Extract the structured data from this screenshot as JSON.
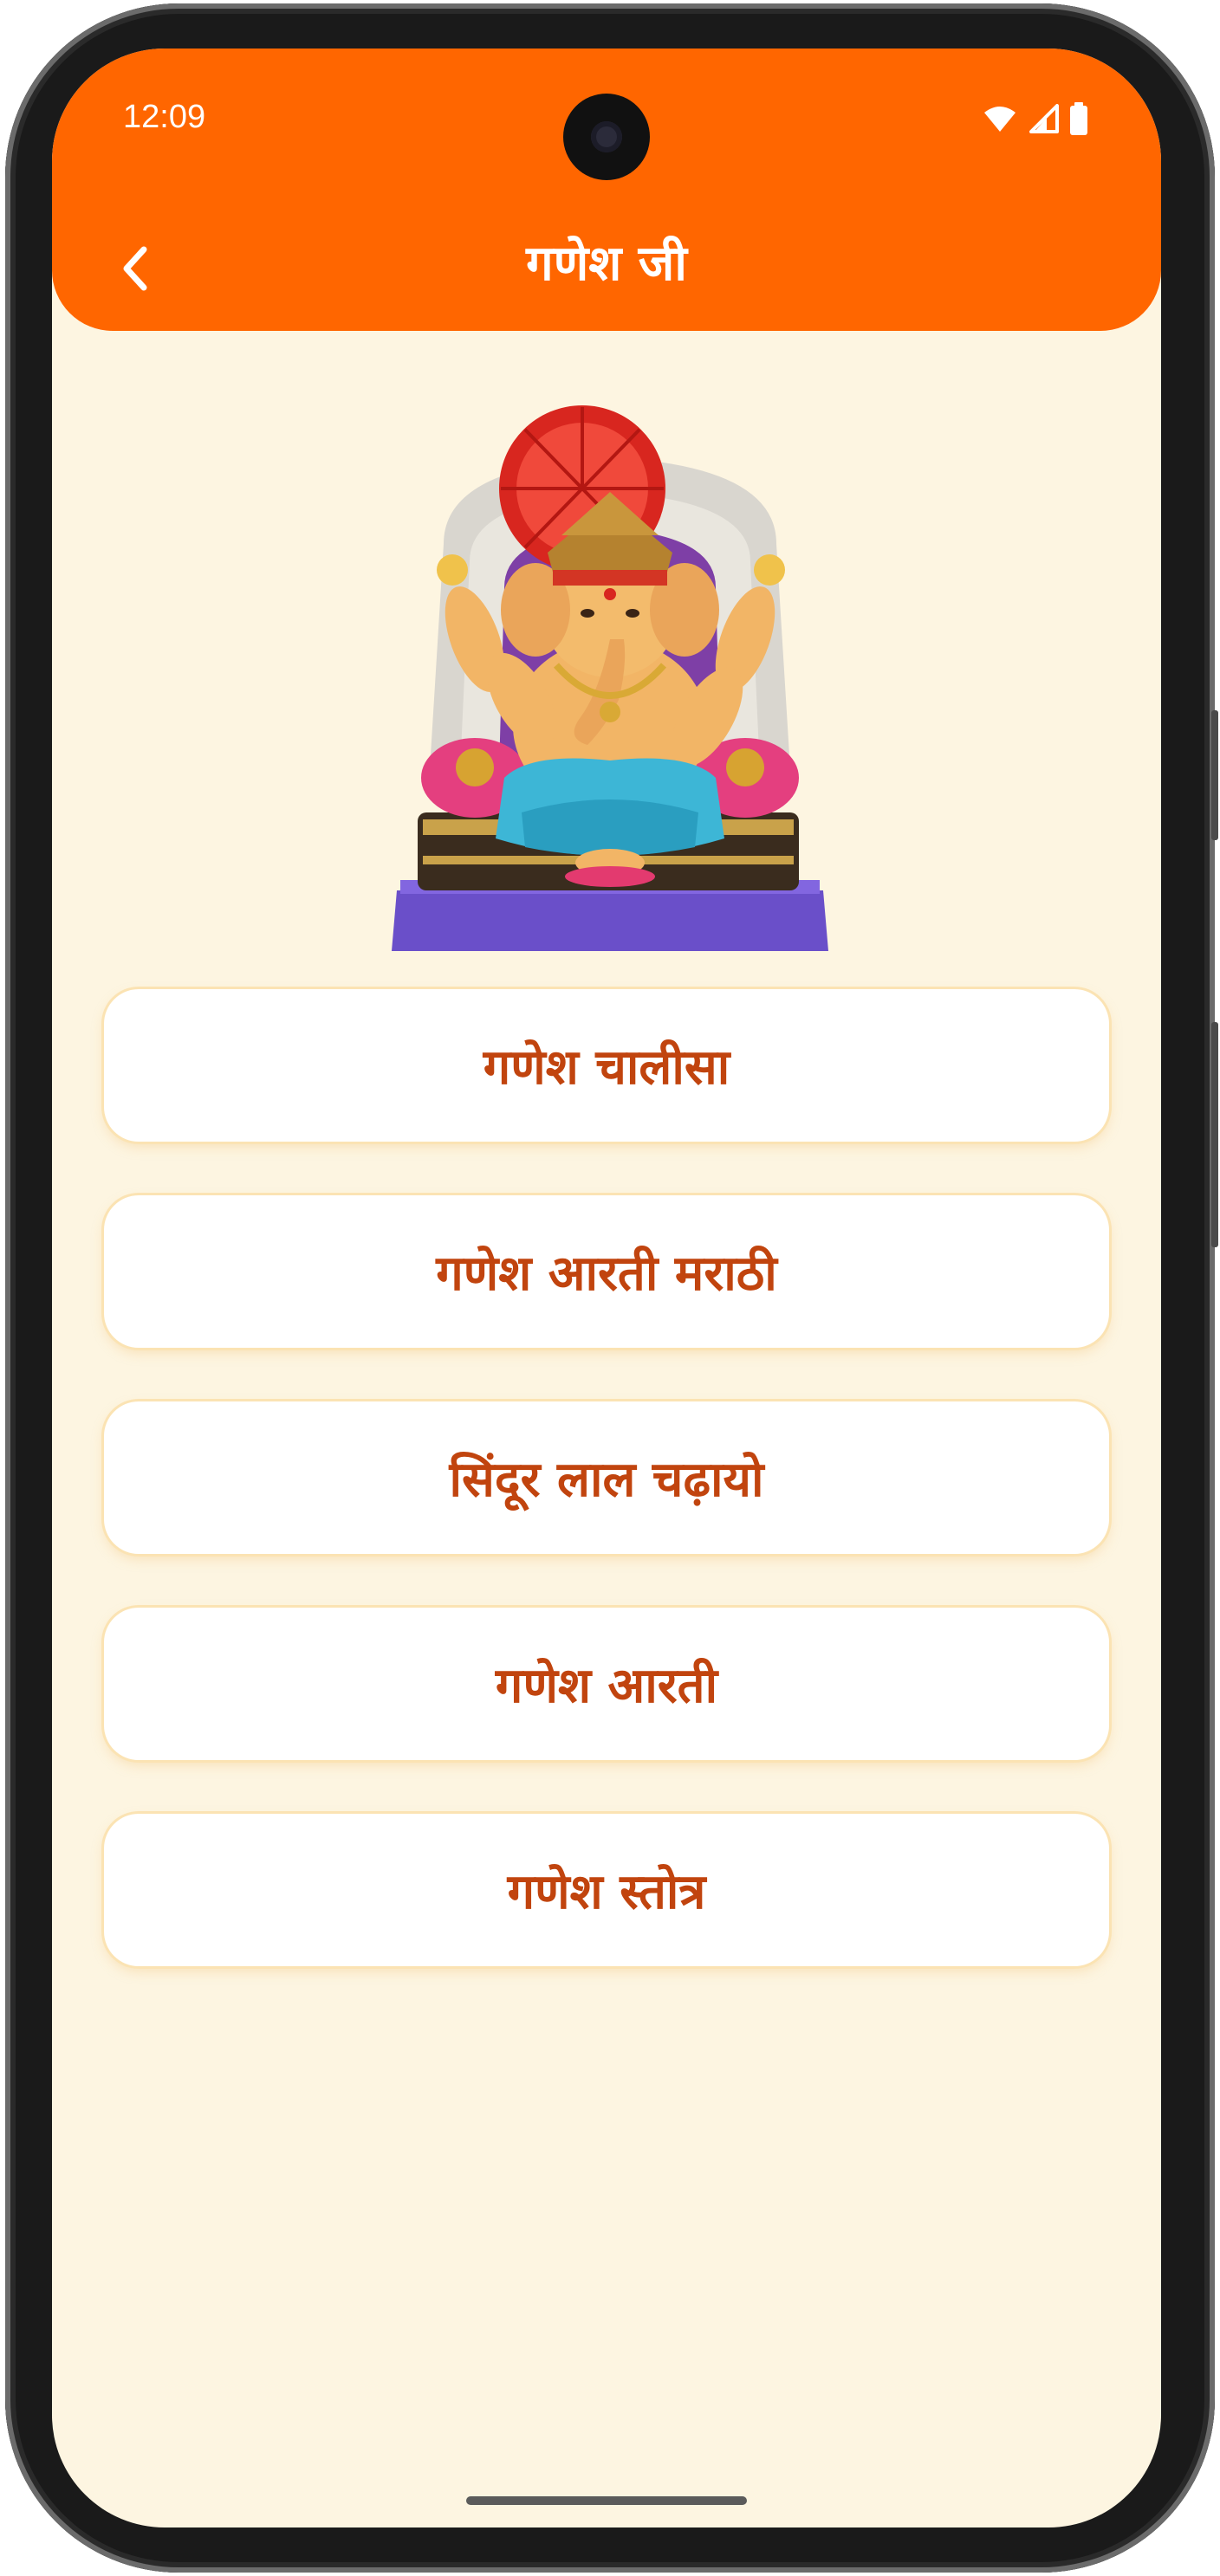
{
  "status_bar": {
    "time": "12:09"
  },
  "app_bar": {
    "title": "गणेश जी",
    "back_icon": "chevron-left-icon"
  },
  "hero_image": {
    "description": "Lord Ganesha idol seated on throne"
  },
  "menu": {
    "items": [
      {
        "label": "गणेश चालीसा"
      },
      {
        "label": "गणेश आरती मराठी"
      },
      {
        "label": "सिंदूर लाल चढ़ायो"
      },
      {
        "label": "गणेश आरती"
      },
      {
        "label": "गणेश स्तोत्र"
      }
    ]
  },
  "colors": {
    "app_bar": "#ff6600",
    "background": "#fdf5e1",
    "item_text": "#c1440e",
    "item_border": "#fbe3b3"
  }
}
